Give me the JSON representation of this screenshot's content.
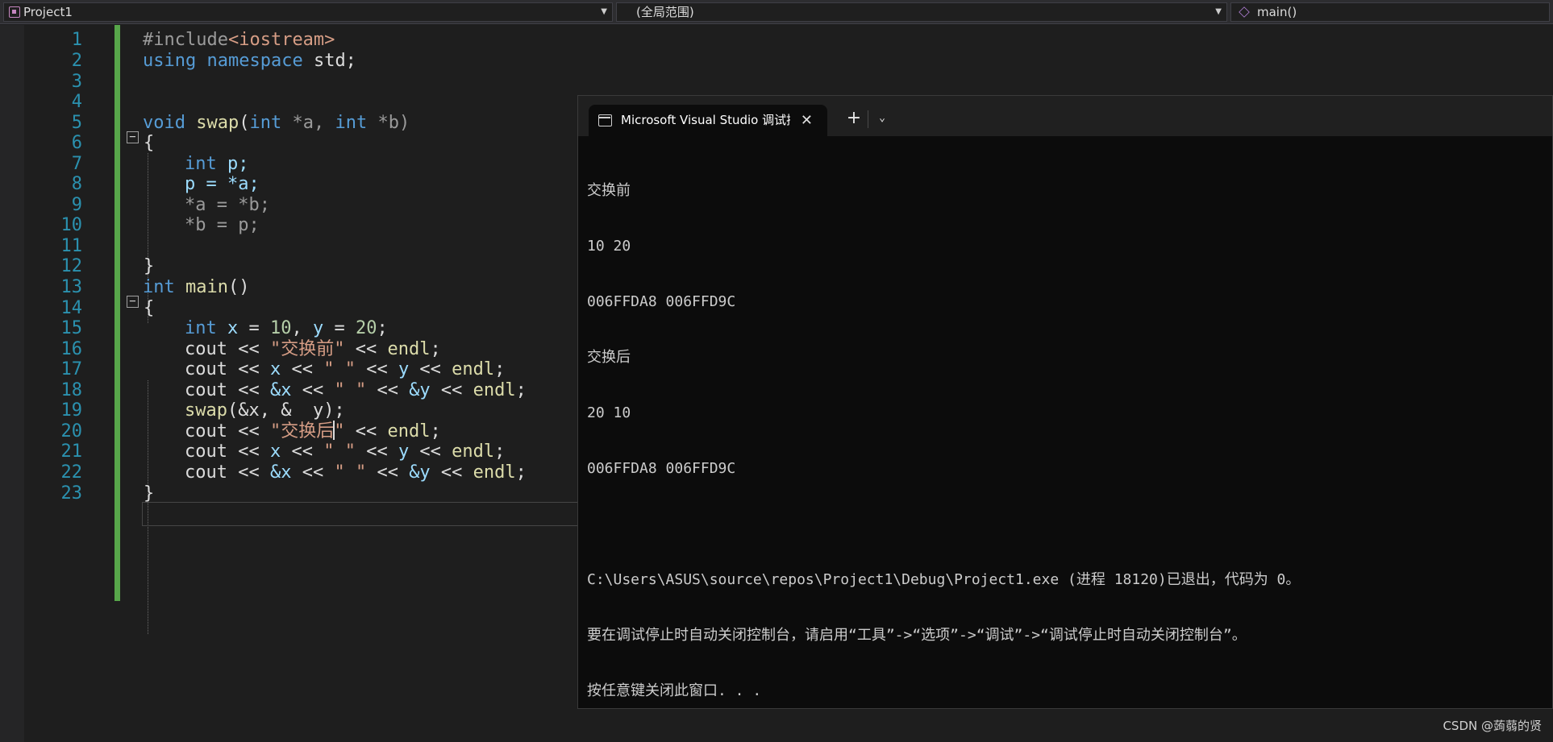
{
  "navbar": {
    "project": "Project1",
    "scope": "(全局范围)",
    "member": "main()"
  },
  "editor": {
    "line_numbers": [
      "1",
      "2",
      "3",
      "4",
      "5",
      "6",
      "7",
      "8",
      "9",
      "10",
      "11",
      "12",
      "13",
      "14",
      "15",
      "16",
      "17",
      "18",
      "19",
      "20",
      "21",
      "22",
      "23"
    ],
    "lines": {
      "l1": {
        "pre": "#include",
        "inc": "<iostream>"
      },
      "l2": {
        "kw1": "using",
        "kw2": "namespace",
        "rest": " std;"
      },
      "l5": {
        "kw": "void",
        "fn": "swap",
        "p1": "(",
        "t1": "int",
        "a": " *a, ",
        "t2": "int",
        "b": " *b)"
      },
      "l6": "{",
      "l7": {
        "kw": "int",
        "v": " p;"
      },
      "l8": "p = *a;",
      "l9": "*a = *b;",
      "l10": "*b = p;",
      "l12": "}",
      "l13": {
        "kw": "int",
        "fn": " main",
        "rest": "()"
      },
      "l14": "{",
      "l15": {
        "kw": "int",
        "x": " x",
        "eq1": " = ",
        "n1": "10",
        "c": ", ",
        "y": "y",
        "eq2": " = ",
        "n2": "20",
        "end": ";"
      },
      "l16": {
        "cout": "cout",
        "op": " << ",
        "str": "\"交换前\"",
        "op2": " << ",
        "endl": "endl",
        "end": ";"
      },
      "l17": {
        "cout": "cout",
        "op": " << ",
        "x": "x",
        "op2": " << ",
        "str": "\" \"",
        "op3": " << ",
        "y": "y",
        "op4": " << ",
        "endl": "endl",
        "end": ";"
      },
      "l18": {
        "cout": "cout",
        "op": " << ",
        "x": "&x",
        "op2": " << ",
        "str": "\" \"",
        "op3": " << ",
        "y": "&y",
        "op4": " << ",
        "endl": "endl",
        "end": ";"
      },
      "l19": {
        "fn": "swap",
        "rest": "(&x, &  y);"
      },
      "l20": {
        "cout": "cout",
        "op": " << ",
        "str_a": "\"交换后",
        "str_b": "\"",
        "op2": " << ",
        "endl": "endl",
        "end": ";"
      },
      "l21": {
        "cout": "cout",
        "op": " << ",
        "x": "x",
        "op2": " << ",
        "str": "\" \"",
        "op3": " << ",
        "y": "y",
        "op4": " << ",
        "endl": "endl",
        "end": ";"
      },
      "l22": {
        "cout": "cout",
        "op": " << ",
        "x": "&x",
        "op2": " << ",
        "str": "\" \"",
        "op3": " << ",
        "y": "&y",
        "op4": " << ",
        "endl": "endl",
        "end": ";"
      },
      "l23": "}"
    },
    "fold_symbol": "−"
  },
  "console": {
    "tab_title": "Microsoft Visual Studio 调试控",
    "close_glyph": "✕",
    "new_tab_glyph": "+",
    "dropdown_glyph": "⌄",
    "output": [
      "交换前",
      "10 20",
      "006FFDA8 006FFD9C",
      "交换后",
      "20 10",
      "006FFDA8 006FFD9C",
      "",
      "C:\\Users\\ASUS\\source\\repos\\Project1\\Debug\\Project1.exe (进程 18120)已退出，代码为 0。",
      "要在调试停止时自动关闭控制台，请启用“工具”->“选项”->“调试”->“调试停止时自动关闭控制台”。",
      "按任意键关闭此窗口. . ."
    ]
  },
  "watermark": "CSDN @蒟蒻的贤"
}
